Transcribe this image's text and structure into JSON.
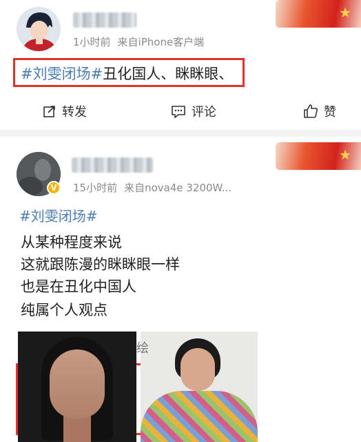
{
  "post1": {
    "meta_time": "1小时前",
    "meta_source": "来自iPhone客户端",
    "topic": "#刘雯闭场#",
    "text": "丑化国人、眯眯眼、",
    "actions": {
      "repost": "转发",
      "comment": "评论",
      "like": "赞"
    }
  },
  "post2": {
    "meta_time": "15小时前",
    "meta_source": "来自nova4e 3200W...",
    "topic": "#刘雯闭场#",
    "lines": [
      "从某种程度来说",
      "这就跟陈漫的眯眯眼一样",
      "也是在丑化中国人",
      "纯属个人观点"
    ],
    "partial_char": "绘"
  },
  "colors": {
    "accent_red": "#e0312a",
    "topic_blue": "#4a7cb6",
    "verified": "#f7b500"
  }
}
